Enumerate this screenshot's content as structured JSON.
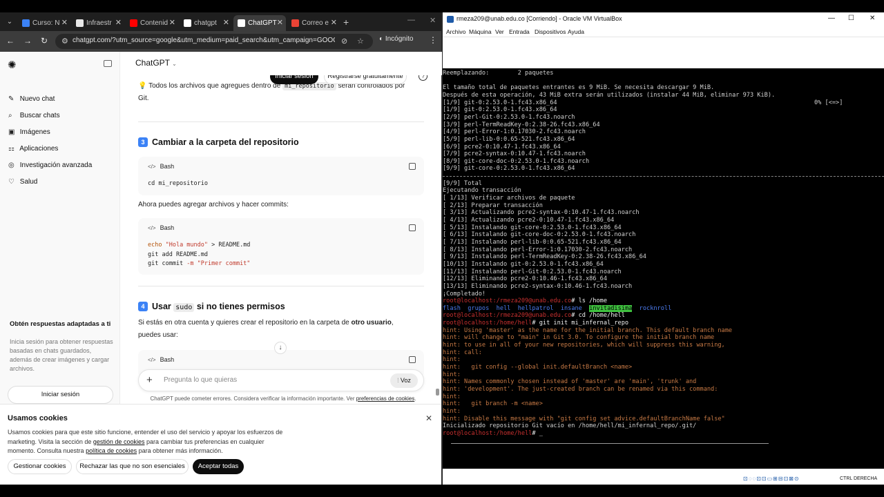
{
  "chrome": {
    "tabs": [
      {
        "title": "Curso: N",
        "color": "#3b82f6"
      },
      {
        "title": "Infraestr",
        "color": "#e8e8e8"
      },
      {
        "title": "Contenid",
        "color": "#ff0000"
      },
      {
        "title": "chatgpt",
        "color": "#ffffff"
      },
      {
        "title": "ChatGPT",
        "color": "#ffffff"
      },
      {
        "title": "Correo e",
        "color": "#ea4335"
      }
    ],
    "url": "chatgpt.com/?utm_source=google&utm_medium=paid_search&utm_campaign=GOOG_C_...",
    "incognito_label": "Incógnito"
  },
  "chatgpt": {
    "model": "ChatGPT",
    "login_button": "Iniciar sesión",
    "register_button": "Registrarse gratuitamente",
    "sidebar": {
      "items": [
        {
          "icon": "✎",
          "label": "Nuevo chat"
        },
        {
          "icon": "⌕",
          "label": "Buscar chats"
        },
        {
          "icon": "▣",
          "label": "Imágenes"
        },
        {
          "icon": "⚏",
          "label": "Aplicaciones"
        },
        {
          "icon": "◎",
          "label": "Investigación avanzada"
        },
        {
          "icon": "♡",
          "label": "Salud"
        }
      ],
      "promo_title": "Obtén respuestas adaptadas a ti",
      "promo_text": "Inicia sesión para obtener respuestas basadas en chats guardados, además de crear imágenes y cargar archivos.",
      "login_button": "Iniciar sesión"
    },
    "content": {
      "para1_pre": "Todos los archivos que agregues dentro de ",
      "para1_code": "mi_repositorio",
      "para1_post": " serán controlados por",
      "para1_line2": "Git.",
      "h3_num": "3",
      "h3_title": "Cambiar a la carpeta del repositorio",
      "bash_label": "Bash",
      "code1": "cd mi_repositorio",
      "para2": "Ahora puedes agregar archivos y hacer commits:",
      "code2_l1_cmd": "echo ",
      "code2_l1_str": "\"Hola mundo\"",
      "code2_l1_rest": " > README.md",
      "code2_l2": "git add README.md",
      "code2_l3_cmd": "git commit ",
      "code2_l3_flag": "-m ",
      "code2_l3_str": "\"Primer commit\"",
      "h4_num": "4",
      "h4_pre": "Usar ",
      "h4_code": "sudo",
      "h4_post": " si no tienes permisos",
      "para3_pre": "Si estás en otra cuenta y quieres crear el repositorio en la carpeta de ",
      "para3_bold": "otro usuario",
      "para3_post": ",",
      "para3_line2": "puedes usar:"
    },
    "composer_placeholder": "Pregunta lo que quieras",
    "voice_button": "Voz",
    "disclaimer_pre": "ChatGPT puede cometer errores. Considera verificar la información importante. Ver ",
    "disclaimer_link": "preferencias de cookies",
    "disclaimer_post": "."
  },
  "cookies": {
    "title": "Usamos cookies",
    "text_1": "Usamos cookies para que este sitio funcione, entender el uso del servicio y apoyar los esfuerzos de marketing. Visita la sección de ",
    "link_1": "gestión de cookies",
    "text_2": " para cambiar tus preferencias en cualquier momento. Consulta nuestra ",
    "link_2": "política de cookies",
    "text_3": " para obtener más información.",
    "btn_manage": "Gestionar cookies",
    "btn_reject": "Rechazar las que no son esenciales",
    "btn_accept": "Aceptar todas"
  },
  "vbox": {
    "title": "rmeza209@unab.edu.co [Corriendo] - Oracle VM VirtualBox",
    "menu": [
      "Archivo",
      "Máquina",
      "Ver",
      "Entrada",
      "Dispositivos",
      "Ayuda"
    ],
    "host_key": "CTRL DERECHA",
    "progress_text": "0% [<=>]",
    "terminal": {
      "lines_a": [
        "Reemplazando:        2 paquetes",
        "",
        "El tamaño total de paquetes entrantes es 9 MiB. Se necesita descargar 9 MiB.",
        "Después de esta operación, 43 MiB extra serán utilizados (instalar 44 MiB, eliminar 973 KiB).",
        "[1/9] git-0:2.53.0-1.fc43.x86_64",
        "[1/9] git-0:2.53.0-1.fc43.x86_64",
        "[2/9] perl-Git-0:2.53.0-1.fc43.noarch",
        "[3/9] perl-TermReadKey-0:2.38-26.fc43.x86_64",
        "[4/9] perl-Error-1:0.17030-2.fc43.noarch",
        "[5/9] perl-lib-0:0.65-521.fc43.x86_64",
        "[6/9] pcre2-0:10.47-1.fc43.x86_64",
        "[7/9] pcre2-syntax-0:10.47-1.fc43.noarch",
        "[8/9] git-core-doc-0:2.53.0-1.fc43.noarch",
        "[9/9] git-core-0:2.53.0-1.fc43.x86_64"
      ],
      "lines_b": [
        "[9/9] Total",
        "Ejecutando transacción",
        "[ 1/13] Verificar archivos de paquete",
        "[ 2/13] Preparar transacción",
        "[ 3/13] Actualizando pcre2-syntax-0:10.47-1.fc43.noarch",
        "[ 4/13] Actualizando pcre2-0:10.47-1.fc43.x86_64",
        "[ 5/13] Instalando git-core-0:2.53.0-1.fc43.x86_64",
        "[ 6/13] Instalando git-core-doc-0:2.53.0-1.fc43.noarch",
        "[ 7/13] Instalando perl-lib-0:0.65-521.fc43.x86_64",
        "[ 8/13] Instalando perl-Error-1:0.17030-2.fc43.noarch",
        "[ 9/13] Instalando perl-TermReadKey-0:2.38-26.fc43.x86_64",
        "[10/13] Instalando git-0:2.53.0-1.fc43.x86_64",
        "[11/13] Instalando perl-Git-0:2.53.0-1.fc43.noarch",
        "[12/13] Eliminando pcre2-0:10.46-1.fc43.x86_64",
        "[13/13] Eliminando pcre2-syntax-0:10.46-1.fc43.noarch",
        "¡Completado!"
      ],
      "prompt_user": "root@localhost",
      "prompt_dir_1": "/rmeza209@unab.edu.co",
      "cmd_1": "# ls /home",
      "ls_items": [
        "flash",
        "grupos",
        "hell",
        "hellpatrol",
        "insane"
      ],
      "ls_highlight": "invitadisima",
      "ls_last": "rocknroll",
      "cmd_2": "# cd /home/hell",
      "prompt_dir_2": "/home/hell",
      "cmd_3": "# git init mi_infernal_repo",
      "hints": [
        "hint: Using 'master' as the name for the initial branch. This default branch name",
        "hint: will change to \"main\" in Git 3.0. To configure the initial branch name",
        "hint: to use in all of your new repositories, which will suppress this warning,",
        "hint: call:",
        "hint:",
        "hint:   git config --global init.defaultBranch <name>",
        "hint:",
        "hint: Names commonly chosen instead of 'master' are 'main', 'trunk' and",
        "hint: 'development'. The just-created branch can be renamed via this command:",
        "hint:",
        "hint:   git branch -m <name>",
        "hint:",
        "hint: Disable this message with \"git config set advice.defaultBranchName false\""
      ],
      "init_result": "Inicializado repositorio Git vacío en /home/hell/mi_infernal_repo/.git/",
      "last_prompt_tail": "# _"
    }
  }
}
